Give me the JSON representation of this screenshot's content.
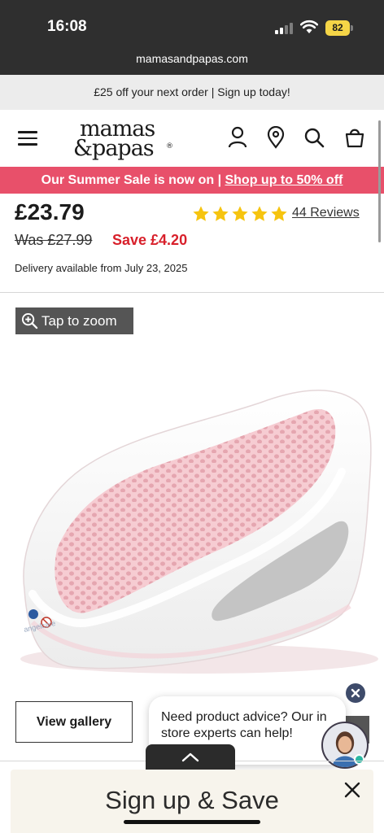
{
  "status_bar": {
    "time": "16:08",
    "battery": "82",
    "battery_color": "#f5d547",
    "signal_icon": "signal-bars-icon",
    "wifi_icon": "wifi-icon"
  },
  "browser": {
    "url": "mamasandpapas.com"
  },
  "promo": {
    "text": "£25 off your next order | Sign up today!"
  },
  "header": {
    "logo_line1": "mamas",
    "logo_line2": "&papas",
    "logo_mark": "®",
    "icons": [
      "menu-icon",
      "account-icon",
      "store-locator-icon",
      "search-icon",
      "basket-icon"
    ]
  },
  "sale_banner": {
    "text": "Our Summer Sale is now on | ",
    "link": "Shop up to 50% off",
    "background": "#e8506a"
  },
  "product": {
    "price": "£23.79",
    "rating_stars": 5,
    "star_color": "#f6c40f",
    "reviews": "44 Reviews",
    "was_price": "Was £27.99",
    "save": "Save £4.20",
    "save_color": "#d8202b",
    "delivery": "Delivery available from July 23, 2025"
  },
  "gallery": {
    "zoom_label": "Tap to zoom",
    "view_gallery_label": "View gallery"
  },
  "chat": {
    "message": "Need product advice? Our in store experts can help!"
  },
  "signup": {
    "title": "Sign up & Save"
  }
}
